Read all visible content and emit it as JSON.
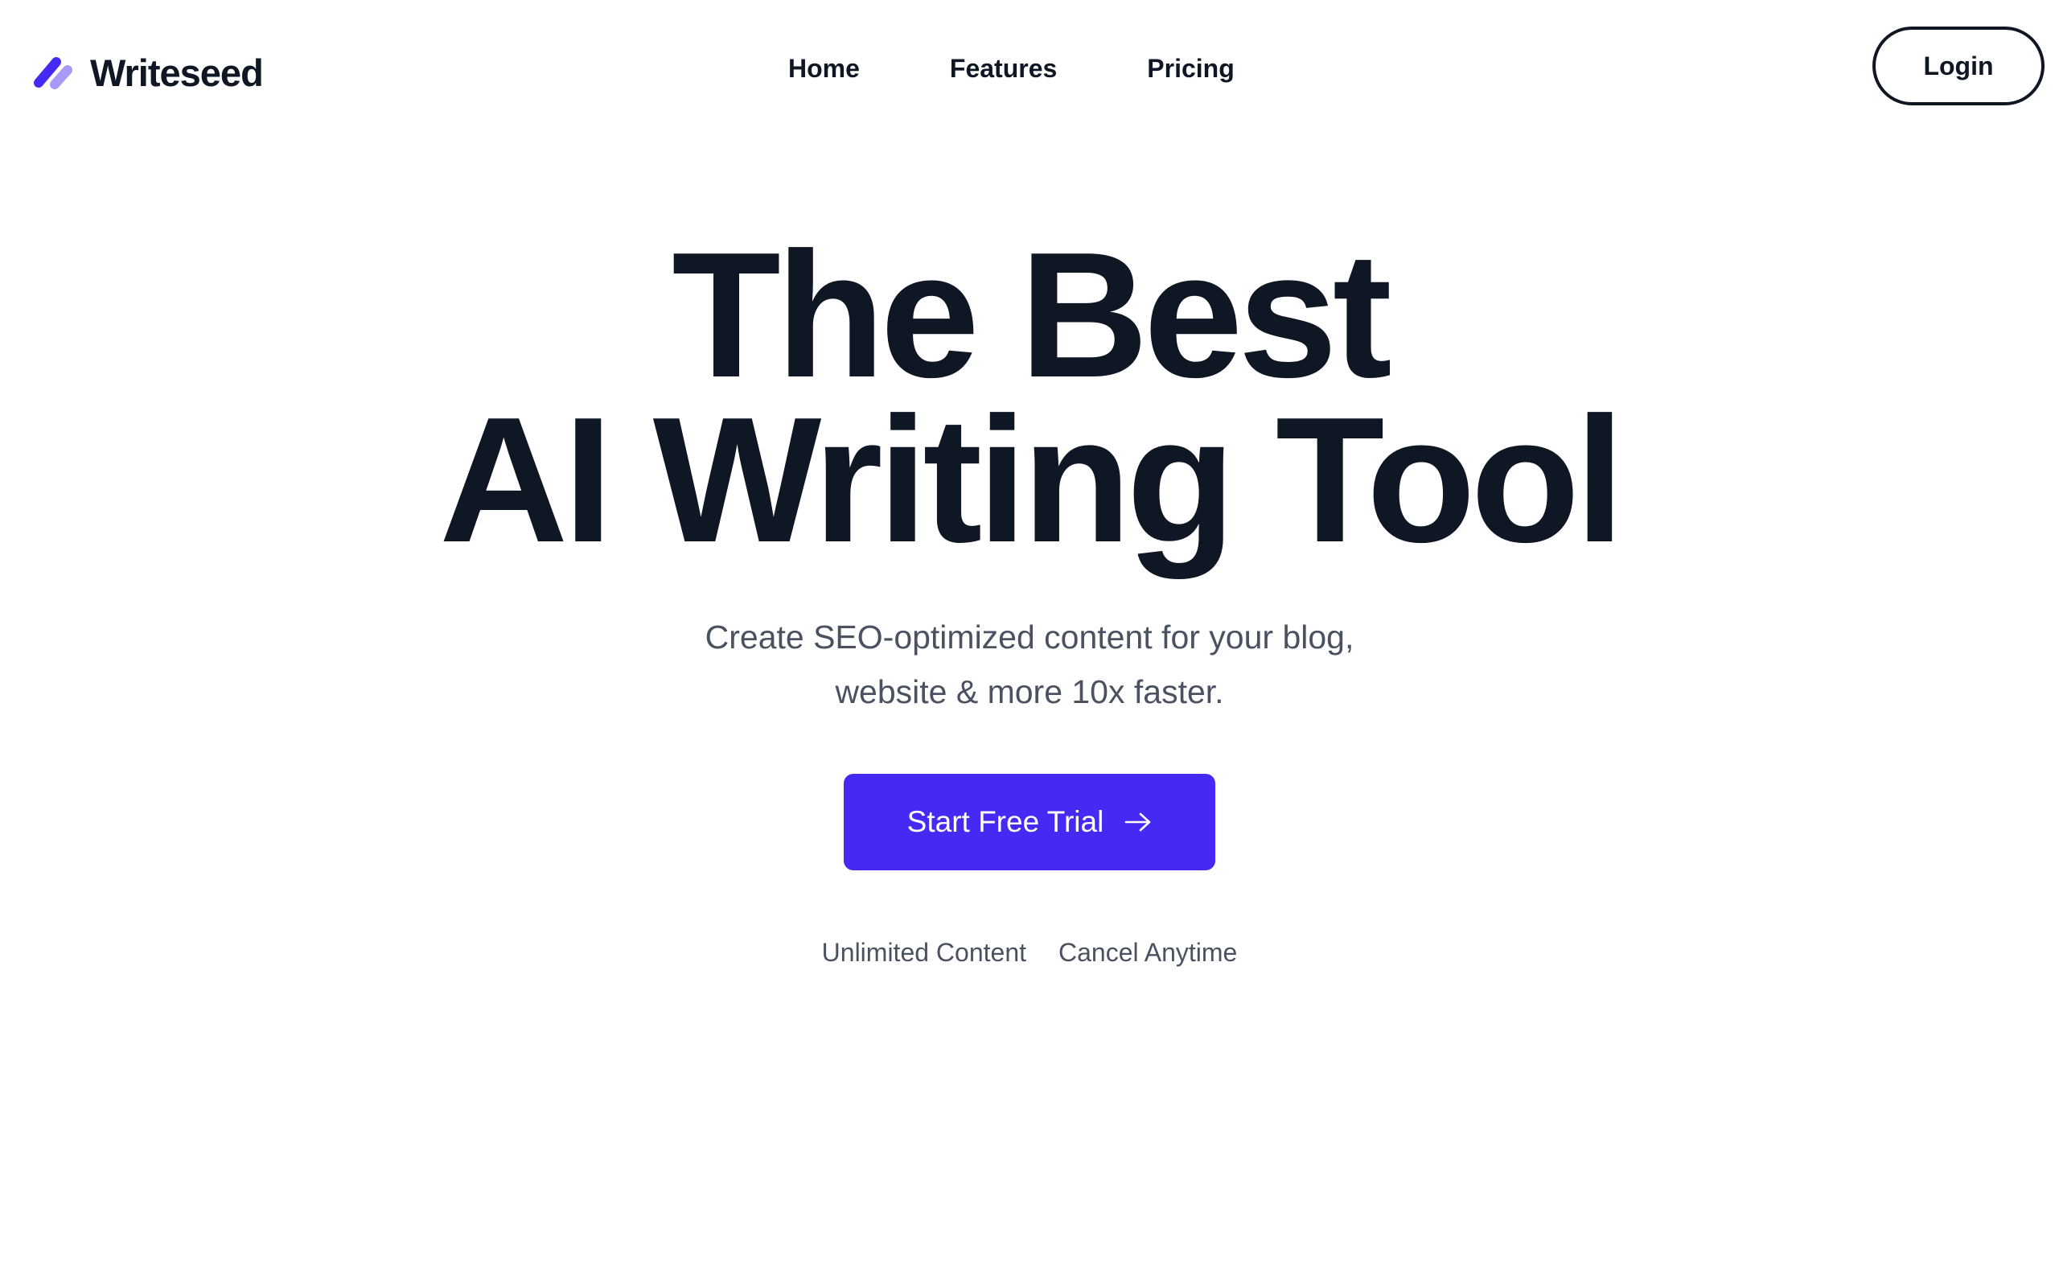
{
  "brand": {
    "name": "Writeseed",
    "logo_icon": "slash-stripes-logo-icon",
    "accent_color": "#4629f2",
    "accent_light_color": "#a89bf7"
  },
  "nav": {
    "items": [
      {
        "label": "Home"
      },
      {
        "label": "Features"
      },
      {
        "label": "Pricing"
      }
    ],
    "login_label": "Login"
  },
  "hero": {
    "title_line1": "The Best",
    "title_line2": "AI Writing Tool",
    "subtitle_line1": "Create SEO-optimized content for your blog,",
    "subtitle_line2": "website & more 10x faster.",
    "cta_label": "Start Free Trial",
    "cta_icon": "arrow-right-icon",
    "perks": [
      "Unlimited Content",
      "Cancel Anytime"
    ]
  },
  "colors": {
    "heading": "#0f1624",
    "body_text": "#4a5261",
    "background": "#ffffff"
  }
}
